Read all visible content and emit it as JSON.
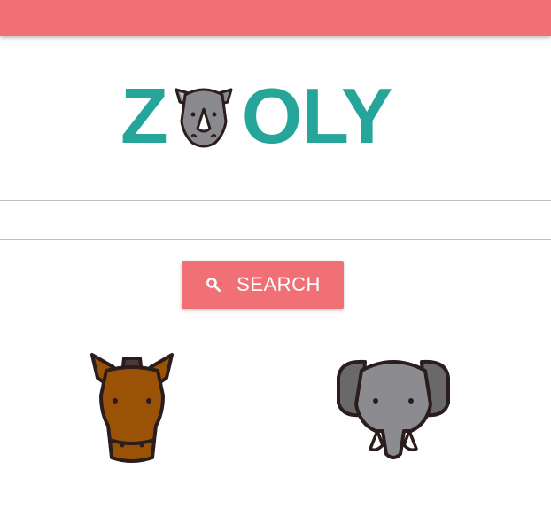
{
  "colors": {
    "accent": "#f07076",
    "brand_teal": "#26a69a",
    "outline": "#2b1d1d",
    "rhino_gray": "#8a8a8e",
    "horse_brown": "#9a5306",
    "elephant_gray": "#8c8c90"
  },
  "header": {
    "logo": {
      "left_text": "Z",
      "right_text": "OLY",
      "icon": "rhino-icon"
    }
  },
  "search": {
    "input_value": "",
    "placeholder": "",
    "button_label": "SEARCH",
    "button_icon": "search-icon"
  },
  "animals": [
    {
      "icon": "horse-icon"
    },
    {
      "icon": "elephant-icon"
    }
  ]
}
